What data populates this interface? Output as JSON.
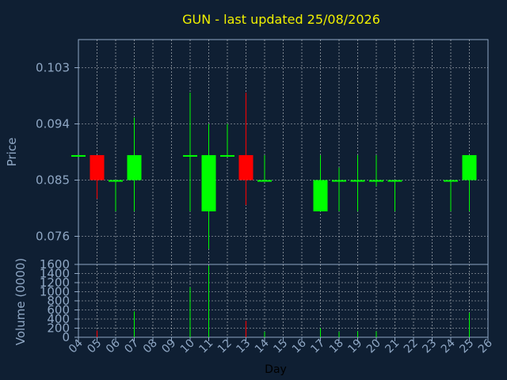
{
  "chart_data": {
    "type": "candlestick",
    "title": "GUN - last updated 25/08/2026",
    "xlabel": "Day",
    "price_ylabel": "Price",
    "volume_ylabel": "Volume (0000)",
    "x_ticks": [
      "04",
      "05",
      "06",
      "07",
      "08",
      "09",
      "10",
      "11",
      "12",
      "13",
      "14",
      "15",
      "16",
      "17",
      "18",
      "19",
      "20",
      "21",
      "22",
      "23",
      "24",
      "25",
      "26"
    ],
    "price_ticks": [
      "0.103",
      "0.094",
      "0.085",
      "0.076"
    ],
    "price_tick_values": [
      0.103,
      0.094,
      0.085,
      0.076
    ],
    "price_ylim": [
      0.0715,
      0.1075
    ],
    "volume_ticks": [
      "1600",
      "1400",
      "1200",
      "1000",
      "800",
      "600",
      "400",
      "200",
      "0"
    ],
    "volume_tick_values": [
      1600,
      1400,
      1200,
      1000,
      800,
      600,
      400,
      200,
      0
    ],
    "volume_ylim": [
      0,
      1600
    ],
    "up_color": "#00ff00",
    "down_color": "#ff0000",
    "background_color": "#0f1f33",
    "axis_color": "#8fa7c4",
    "grid": true,
    "candles": [
      {
        "day": 4,
        "open": 0.089,
        "high": 0.089,
        "low": 0.089,
        "close": 0.089,
        "volume": 0
      },
      {
        "day": 5,
        "open": 0.089,
        "high": 0.089,
        "low": 0.082,
        "close": 0.085,
        "volume": 150
      },
      {
        "day": 6,
        "open": 0.085,
        "high": 0.085,
        "low": 0.08,
        "close": 0.085,
        "volume": 0
      },
      {
        "day": 7,
        "open": 0.085,
        "high": 0.095,
        "low": 0.08,
        "close": 0.089,
        "volume": 570
      },
      {
        "day": 10,
        "open": 0.089,
        "high": 0.099,
        "low": 0.08,
        "close": 0.089,
        "volume": 1100
      },
      {
        "day": 11,
        "open": 0.08,
        "high": 0.094,
        "low": 0.074,
        "close": 0.089,
        "volume": 1570
      },
      {
        "day": 12,
        "open": 0.089,
        "high": 0.094,
        "low": 0.089,
        "close": 0.089,
        "volume": 0
      },
      {
        "day": 13,
        "open": 0.089,
        "high": 0.099,
        "low": 0.081,
        "close": 0.085,
        "volume": 360
      },
      {
        "day": 14,
        "open": 0.085,
        "high": 0.089,
        "low": 0.085,
        "close": 0.085,
        "volume": 120
      },
      {
        "day": 17,
        "open": 0.08,
        "high": 0.089,
        "low": 0.08,
        "close": 0.085,
        "volume": 200
      },
      {
        "day": 18,
        "open": 0.085,
        "high": 0.087,
        "low": 0.08,
        "close": 0.085,
        "volume": 120
      },
      {
        "day": 19,
        "open": 0.085,
        "high": 0.089,
        "low": 0.08,
        "close": 0.085,
        "volume": 130
      },
      {
        "day": 20,
        "open": 0.085,
        "high": 0.089,
        "low": 0.084,
        "close": 0.085,
        "volume": 130
      },
      {
        "day": 21,
        "open": 0.085,
        "high": 0.085,
        "low": 0.08,
        "close": 0.085,
        "volume": 0
      },
      {
        "day": 24,
        "open": 0.085,
        "high": 0.085,
        "low": 0.08,
        "close": 0.085,
        "volume": 0
      },
      {
        "day": 25,
        "open": 0.085,
        "high": 0.089,
        "low": 0.08,
        "close": 0.089,
        "volume": 540
      }
    ]
  }
}
